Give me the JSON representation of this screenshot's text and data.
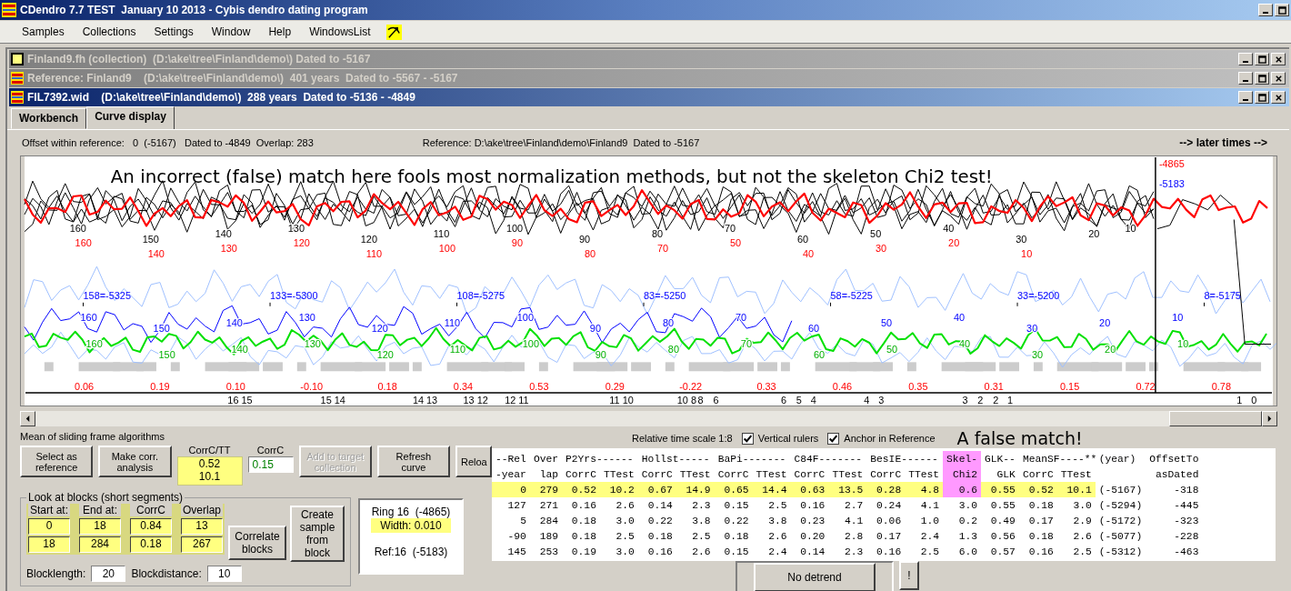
{
  "window": {
    "title": "CDendro 7.7 TEST  January 10 2013 - Cybis dendro dating program"
  },
  "menu": [
    "Samples",
    "Collections",
    "Settings",
    "Window",
    "Help",
    "WindowsList"
  ],
  "documents": [
    {
      "title": "Finland9.fh (collection)  (D:\\ake\\tree\\Finland\\demo\\) Dated to -5167",
      "active": false,
      "kind": "collection"
    },
    {
      "title": "Reference: Finland9    (D:\\ake\\tree\\Finland\\demo\\)  401 years  Dated to -5567 - -5167",
      "active": false,
      "kind": "sample"
    },
    {
      "title": "FIL7392.wid    (D:\\ake\\tree\\Finland\\demo\\)  288 years  Dated to -5136 - -4849",
      "active": true,
      "kind": "sample"
    }
  ],
  "tabs": [
    {
      "label": "Workbench",
      "selected": false
    },
    {
      "label": "Curve display",
      "selected": true
    }
  ],
  "info": {
    "offset": "Offset within reference:   0  (-5167)   Dated to -4849  Overlap: 283",
    "reference": "Reference: D:\\ake\\tree\\Finland\\demo\\Finland9  Dated to -5167",
    "direction": "--> later times -->"
  },
  "chart": {
    "annotation": "An incorrect (false) match here fools most normalization methods, but not the skeleton Chi2 test!",
    "cursor_labels": [
      {
        "text": "-4865",
        "kind": "sample"
      },
      {
        "text": "-5183",
        "kind": "reference"
      }
    ],
    "year_markers": [
      "158=-5325",
      "133=-5300",
      "108=-5275",
      "83=-5250",
      "58=-5225",
      "33=-5200",
      "8=-5175"
    ],
    "correlations": [
      "0.06",
      "0.19",
      "0.10",
      "-0.10",
      "0.18",
      "0.34",
      "0.53",
      "0.29",
      "-0.22",
      "0.33",
      "0.46",
      "0.35",
      "0.31",
      "0.15",
      "0.72",
      "0.78"
    ],
    "ring_numbers": [
      "16 15",
      "15 14",
      "14 13",
      "13 12",
      "12 11",
      "11 10",
      "10 8",
      "8",
      "6",
      "6",
      "5",
      "4",
      "4",
      "3",
      "3",
      "2",
      "2",
      "1",
      "1",
      "0"
    ],
    "curve_labels": [
      {
        "kind": "ring-width",
        "labels": [
          "160",
          "150",
          "140",
          "130",
          "120",
          "110",
          "100",
          "90",
          "80",
          "70",
          "60",
          "50",
          "40",
          "30",
          "20",
          "10"
        ]
      },
      {
        "kind": "mean",
        "labels": [
          "160",
          "140",
          "130",
          "120",
          "110",
          "100",
          "90",
          "80",
          "70",
          "50",
          "40",
          "30",
          "20",
          "10"
        ]
      },
      {
        "kind": "index",
        "labels": [
          "160",
          "150",
          "140",
          "130",
          "120",
          "110",
          "100",
          "90",
          "80",
          "70",
          "60",
          "50",
          "40",
          "30",
          "20",
          "10"
        ]
      },
      {
        "kind": "skeleton",
        "labels": [
          "160",
          "150",
          "140",
          "130",
          "120",
          "110",
          "100",
          "90",
          "80",
          "70",
          "60",
          "50",
          "40",
          "30",
          "20",
          "10"
        ]
      }
    ]
  },
  "caption": "Mean of sliding frame algorithms",
  "toolbar": [
    {
      "kind": "button",
      "label": "Select as reference",
      "disabled": false
    },
    {
      "kind": "button",
      "label": "Make corr. analysis",
      "disabled": false
    },
    {
      "kind": "readout",
      "label": "CorrC/TT",
      "values": [
        "0.52",
        "10.1"
      ]
    },
    {
      "kind": "field",
      "label": "CorrC",
      "value": "0.15"
    },
    {
      "kind": "button",
      "label": "Add to target collection",
      "disabled": true
    },
    {
      "kind": "button",
      "label": "Refresh curve",
      "disabled": false
    },
    {
      "kind": "button",
      "label": "Reloa",
      "disabled": false
    }
  ],
  "blocks": {
    "title": "Look at blocks (short segments)",
    "headers": [
      "Start at:",
      "End at:",
      "CorrC",
      "Overlap"
    ],
    "rows": [
      [
        "0",
        "18",
        "0.84",
        "13"
      ],
      [
        "18",
        "284",
        "0.18",
        "267"
      ]
    ],
    "buttons": [
      "Correlate blocks",
      "Create sample from block"
    ],
    "settings": [
      {
        "label": "Blocklength:",
        "value": "20"
      },
      {
        "label": "Blockdistance:",
        "value": "10"
      }
    ]
  },
  "ring_info": {
    "ring": "Ring 16  (-4865)",
    "width": "Width: 0.010",
    "ref": "Ref:16  (-5183)"
  },
  "options": {
    "scale": "Relative time scale 1:8",
    "checks": [
      {
        "label": "Vertical rulers",
        "checked": true
      },
      {
        "label": "Anchor in Reference",
        "checked": true
      }
    ],
    "note": "A false match!"
  },
  "detrend": {
    "button": "No detrend",
    "extra": "!"
  },
  "results": {
    "columns": [
      {
        "top": "--Rel",
        "bottom": "-year",
        "kind": "value"
      },
      {
        "top": "Over",
        "bottom": "lap",
        "kind": "value"
      },
      {
        "top": "P2Yrs------",
        "bottom": "CorrC",
        "kind": "value"
      },
      {
        "bottom": "TTest",
        "kind": "value"
      },
      {
        "top": "Hollst-----",
        "bottom": "CorrC",
        "kind": "value"
      },
      {
        "bottom": "TTest",
        "kind": "value"
      },
      {
        "top": "BaPi-------",
        "bottom": "CorrC",
        "kind": "value"
      },
      {
        "bottom": "TTest",
        "kind": "value"
      },
      {
        "top": "C84F-------",
        "bottom": "CorrC",
        "kind": "value"
      },
      {
        "bottom": "TTest",
        "kind": "value"
      },
      {
        "top": "BesIE------",
        "bottom": "CorrC",
        "kind": "value"
      },
      {
        "bottom": "TTest",
        "kind": "value"
      },
      {
        "top": "Skel-",
        "bottom": "Chi2",
        "kind": "skeleton"
      },
      {
        "top": "GLK--",
        "bottom": "GLK",
        "kind": "value"
      },
      {
        "top": "MeanSF----**",
        "bottom": "CorrC",
        "kind": "value"
      },
      {
        "bottom": "TTest",
        "kind": "value"
      },
      {
        "top": "(year)",
        "kind": "info"
      },
      {
        "top": "OffsetTo",
        "bottom": "asDated",
        "kind": "info"
      }
    ],
    "rows": [
      {
        "selected": true,
        "cells": [
          "0",
          "279",
          "0.52",
          "10.2",
          "0.67",
          "14.9",
          "0.65",
          "14.4",
          "0.63",
          "13.5",
          "0.28",
          "4.8",
          "0.6",
          "0.55",
          "0.52",
          "10.1",
          "(-5167)",
          "-318"
        ]
      },
      {
        "selected": false,
        "cells": [
          "127",
          "271",
          "0.16",
          "2.6",
          "0.14",
          "2.3",
          "0.15",
          "2.5",
          "0.16",
          "2.7",
          "0.24",
          "4.1",
          "3.0",
          "0.55",
          "0.18",
          "3.0",
          "(-5294)",
          "-445"
        ]
      },
      {
        "selected": false,
        "cells": [
          "5",
          "284",
          "0.18",
          "3.0",
          "0.22",
          "3.8",
          "0.22",
          "3.8",
          "0.23",
          "4.1",
          "0.06",
          "1.0",
          "0.2",
          "0.49",
          "0.17",
          "2.9",
          "(-5172)",
          "-323"
        ]
      },
      {
        "selected": false,
        "cells": [
          "-90",
          "189",
          "0.18",
          "2.5",
          "0.18",
          "2.5",
          "0.18",
          "2.6",
          "0.20",
          "2.8",
          "0.17",
          "2.4",
          "1.3",
          "0.56",
          "0.18",
          "2.6",
          "(-5077)",
          "-228"
        ]
      },
      {
        "selected": false,
        "cells": [
          "145",
          "253",
          "0.19",
          "3.0",
          "0.16",
          "2.6",
          "0.15",
          "2.4",
          "0.14",
          "2.3",
          "0.16",
          "2.5",
          "6.0",
          "0.57",
          "0.16",
          "2.5",
          "(-5312)",
          "-463"
        ]
      }
    ]
  }
}
